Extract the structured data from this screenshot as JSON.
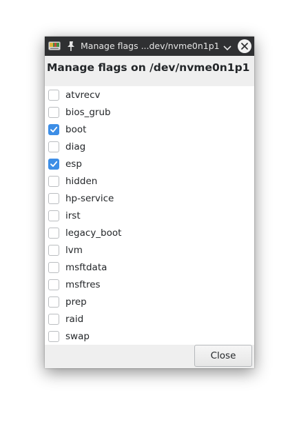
{
  "window": {
    "title": "Manage flags ...dev/nvme0n1p1"
  },
  "header": {
    "title": "Manage flags on /dev/nvme0n1p1"
  },
  "flags": [
    {
      "label": "atvrecv",
      "checked": false
    },
    {
      "label": "bios_grub",
      "checked": false
    },
    {
      "label": "boot",
      "checked": true
    },
    {
      "label": "diag",
      "checked": false
    },
    {
      "label": "esp",
      "checked": true
    },
    {
      "label": "hidden",
      "checked": false
    },
    {
      "label": "hp-service",
      "checked": false
    },
    {
      "label": "irst",
      "checked": false
    },
    {
      "label": "legacy_boot",
      "checked": false
    },
    {
      "label": "lvm",
      "checked": false
    },
    {
      "label": "msftdata",
      "checked": false
    },
    {
      "label": "msftres",
      "checked": false
    },
    {
      "label": "prep",
      "checked": false
    },
    {
      "label": "raid",
      "checked": false
    },
    {
      "label": "swap",
      "checked": false
    }
  ],
  "footer": {
    "close_label": "Close"
  },
  "icons": {
    "app": "gparted-icon",
    "pin": "pin-icon",
    "minimize": "chevron-down-icon",
    "close": "close-icon",
    "check": "checkmark-icon"
  },
  "colors": {
    "titlebar": "#2f3032",
    "checkbox_checked": "#3d8ee6",
    "panel": "#efefef"
  }
}
